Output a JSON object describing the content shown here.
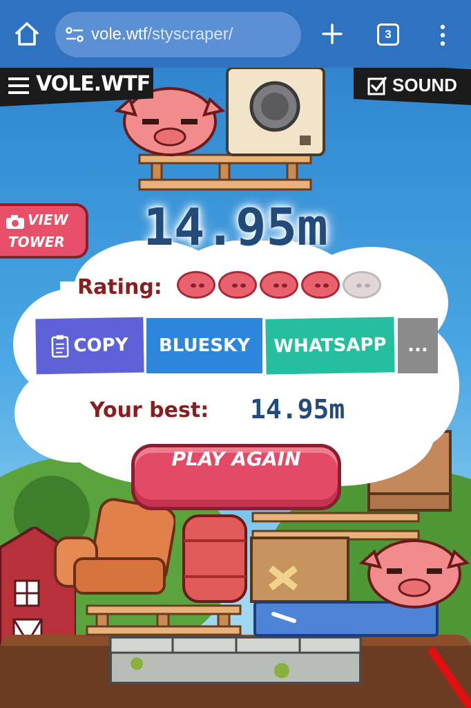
{
  "browser": {
    "url_host": "vole.wtf",
    "url_path": "/styscraper/",
    "tab_count": "3",
    "icons": [
      "home-icon",
      "site-settings-icon",
      "new-tab-plus-icon",
      "tab-switcher-icon",
      "more-menu-icon"
    ]
  },
  "game": {
    "logo": "VOLE.WTF",
    "sound_label": "SOUND",
    "sound_enabled": true,
    "view_tower_line1": "VIEW",
    "view_tower_line2": "TOWER",
    "height": "14.95m",
    "rating_label": "Rating:",
    "rating_value": 4,
    "rating_max": 5,
    "share": {
      "copy": "COPY",
      "bluesky": "BLUESKY",
      "whatsapp": "WHATSAPP",
      "more": "..."
    },
    "best_label": "Your best:",
    "best_value": "14.95m",
    "play_again": "PLAY AGAIN"
  },
  "colors": {
    "chrome": "#2e72c0",
    "urlbar": "#5b90d4",
    "height_text": "#234b7a",
    "rating_text": "#8a1d1d",
    "play_button": "#e24a66",
    "copy": "#5e62d6",
    "bluesky": "#2d86dc",
    "whatsapp": "#25bfa0",
    "more": "#8b8b8b"
  }
}
